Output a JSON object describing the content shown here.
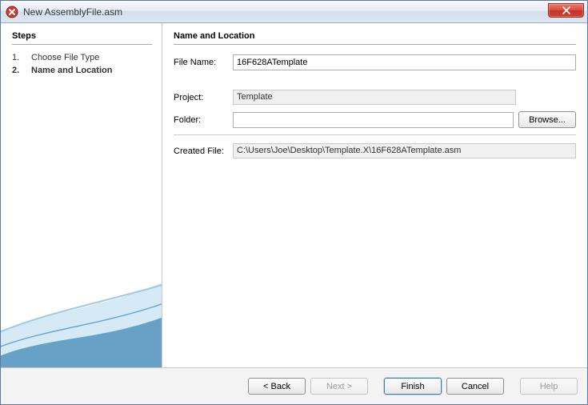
{
  "window": {
    "title": "New AssemblyFile.asm"
  },
  "steps": {
    "heading": "Steps",
    "items": [
      {
        "num": "1.",
        "label": "Choose File Type"
      },
      {
        "num": "2.",
        "label": "Name and Location"
      }
    ],
    "activeIndex": 1
  },
  "content": {
    "heading": "Name and Location",
    "fileNameLabel": "File Name:",
    "fileNameValue": "16F628ATemplate",
    "projectLabel": "Project:",
    "projectValue": "Template",
    "folderLabel": "Folder:",
    "folderValue": "",
    "browseLabel": "Browse...",
    "createdFileLabel": "Created File:",
    "createdFileValue": "C:\\Users\\Joe\\Desktop\\Template.X\\16F628ATemplate.asm"
  },
  "buttons": {
    "back": "< Back",
    "next": "Next >",
    "finish": "Finish",
    "cancel": "Cancel",
    "help": "Help"
  }
}
